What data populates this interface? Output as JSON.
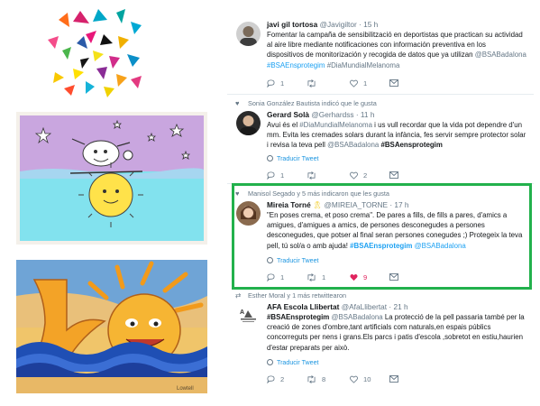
{
  "artworks": [
    {
      "name": "triangles-collage"
    },
    {
      "name": "child-drawing-skier-on-sun"
    },
    {
      "name": "child-drawing-smiling-sun-waves",
      "signature": "Lowtell"
    }
  ],
  "colors": {
    "accent_link": "#1da1f2",
    "text_muted": "#657786",
    "like_red": "#e0245e",
    "highlight_border": "#22b14c"
  },
  "tweets": [
    {
      "context": "",
      "name": "javi gil tortosa",
      "handle": "@Javigiltor",
      "time": "· 15 h",
      "lines": [
        [
          {
            "t": "Fomentar la campaña de sensibilització en deportistas que practican su actividad"
          }
        ],
        [
          {
            "t": "al aire libre mediante notificaciones con información preventiva en los"
          }
        ],
        [
          {
            "t": "dispositivos de monitorización y recogida de datos que ya utilizan "
          },
          {
            "t": "@BSABadalona",
            "k": "ment"
          }
        ],
        [
          {
            "t": "#BSAEnsprotegim",
            "k": "tag"
          },
          {
            "t": " "
          },
          {
            "t": "#DiaMundialMelanoma",
            "k": "ment"
          }
        ]
      ],
      "translate": "",
      "replies": "1",
      "retweets": "",
      "likes": "1"
    },
    {
      "context": "Sonia González Bautista indicó que le gusta",
      "name": "Gerard Solà",
      "handle": "@Gerhardss",
      "time": "· 11 h",
      "lines": [
        [
          {
            "t": "Avui és el "
          },
          {
            "t": "#DiaMundialMelanoma",
            "k": "ment"
          },
          {
            "t": " i us vull recordar que la vida pot dependre d'un"
          }
        ],
        [
          {
            "t": "mm. Evita les cremades solars durant la infància, fes servir sempre protector solar"
          }
        ],
        [
          {
            "t": "i revisa la teva pell "
          },
          {
            "t": "@BSABadalona",
            "k": "ment"
          },
          {
            "t": " "
          },
          {
            "t": "#BSAensprotegim",
            "k": "bold"
          }
        ]
      ],
      "translate": "Traducir Tweet",
      "replies": "1",
      "retweets": "",
      "likes": "2"
    },
    {
      "context": "Manisol Segado y 5 más indicaron que les gusta",
      "name": "Mireia Torné",
      "handle": "@MIREIA_TORNE",
      "time": "· 17 h",
      "lines": [
        [
          {
            "t": "\"En poses crema, et poso crema\". De pares a fills, de fills a pares, d'amics a"
          }
        ],
        [
          {
            "t": "amigues, d'amigues a amics, de persones desconegudes a persones"
          }
        ],
        [
          {
            "t": "desconegudes, que potser al final seran persones conegudes ;) Protegeix la teva"
          }
        ],
        [
          {
            "t": "pell, tú sol/a o amb ajuda! "
          },
          {
            "t": "#BSAEnsprotegim",
            "k": "tagb"
          },
          {
            "t": " "
          },
          {
            "t": "@BSABadalona",
            "k": "tag"
          }
        ]
      ],
      "translate": "Traducir Tweet",
      "replies": "1",
      "retweets": "1",
      "likes": "9"
    },
    {
      "context": "Esther Moral y 1 más retwittearon",
      "name": "AFA Escola Llibertat",
      "handle": "@AfaLlibertat",
      "time": "· 21 h",
      "lines": [
        [
          {
            "t": "#BSAEnsprotegim",
            "k": "bold"
          },
          {
            "t": " "
          },
          {
            "t": "@BSABadalona",
            "k": "ment"
          },
          {
            "t": " La protecció de la pell passaria també per la"
          }
        ],
        [
          {
            "t": "creació de zones d'ombre,tant artificials com naturals,en espais públics"
          }
        ],
        [
          {
            "t": "concorreguts per nens i grans.Els parcs i patis d'escola ,sobretot en estiu,haurien"
          }
        ],
        [
          {
            "t": "d'estar preparats per això."
          }
        ]
      ],
      "translate": "Traducir Tweet",
      "replies": "2",
      "retweets": "8",
      "likes": "10"
    }
  ]
}
